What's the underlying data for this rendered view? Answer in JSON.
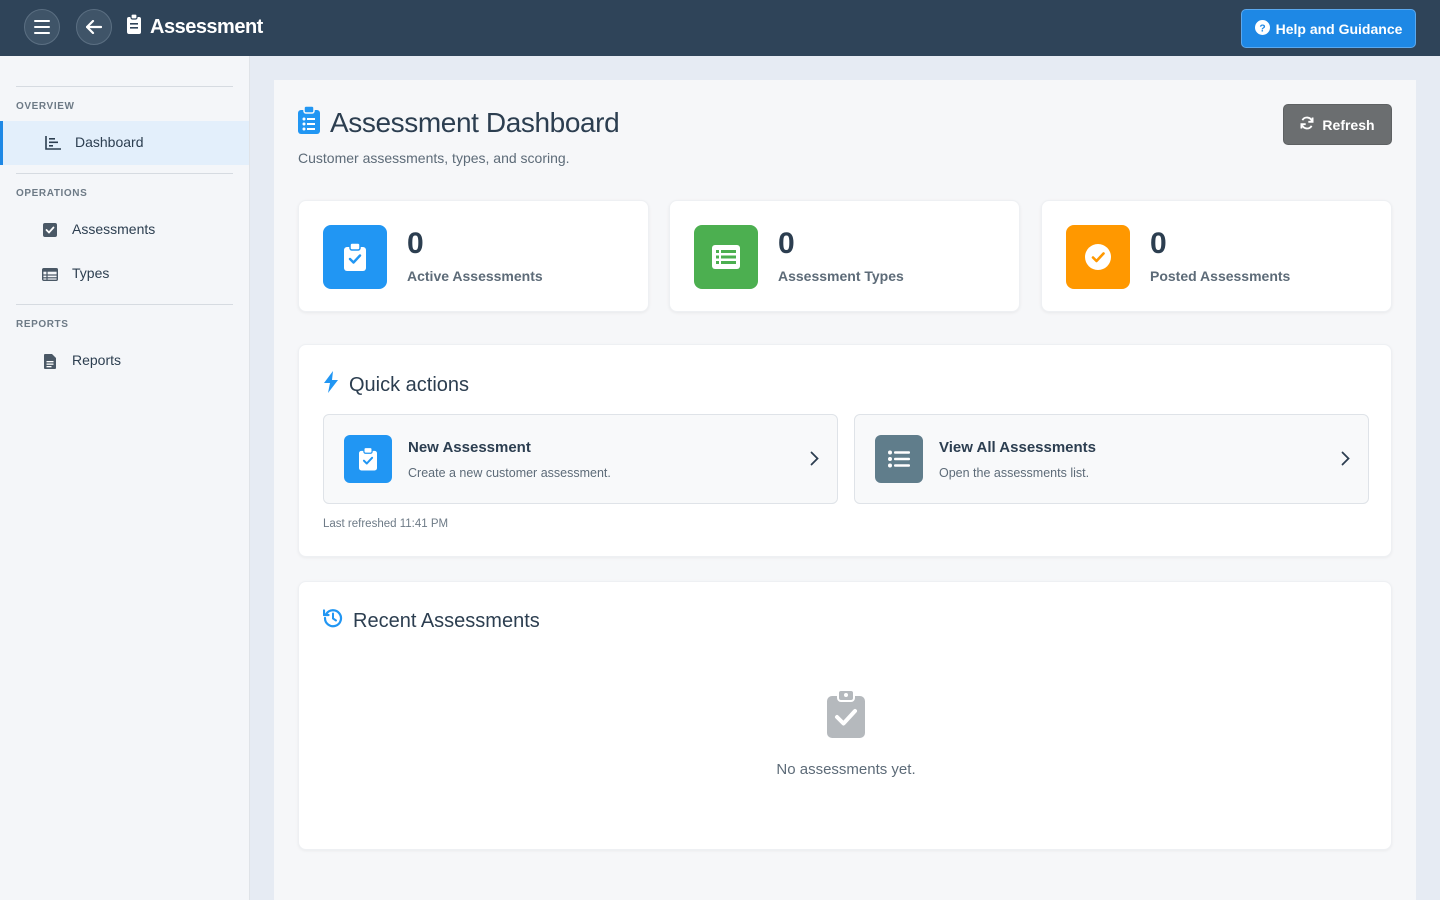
{
  "topbar": {
    "title": "Assessment",
    "help_label": "Help and Guidance"
  },
  "sidebar": {
    "sections": [
      {
        "title": "OVERVIEW",
        "items": [
          {
            "label": "Dashboard",
            "active": true
          }
        ]
      },
      {
        "title": "OPERATIONS",
        "items": [
          {
            "label": "Assessments"
          },
          {
            "label": "Types"
          }
        ]
      },
      {
        "title": "REPORTS",
        "items": [
          {
            "label": "Reports"
          }
        ]
      }
    ]
  },
  "main": {
    "title": "Assessment Dashboard",
    "subtitle": "Customer assessments, types, and scoring.",
    "refresh_label": "Refresh",
    "stats": [
      {
        "value": "0",
        "label": "Active Assessments",
        "color": "#2196f3"
      },
      {
        "value": "0",
        "label": "Assessment Types",
        "color": "#4caf50"
      },
      {
        "value": "0",
        "label": "Posted Assessments",
        "color": "#ff9800"
      }
    ],
    "quick_actions": {
      "title": "Quick actions",
      "cards": [
        {
          "title": "New Assessment",
          "desc": "Create a new customer assessment.",
          "color": "#2196f3"
        },
        {
          "title": "View All Assessments",
          "desc": "Open the assessments list.",
          "color": "#607d8b"
        }
      ],
      "last_refreshed": "Last refreshed 11:41 PM"
    },
    "recent": {
      "title": "Recent Assessments",
      "empty_text": "No assessments yet."
    }
  }
}
